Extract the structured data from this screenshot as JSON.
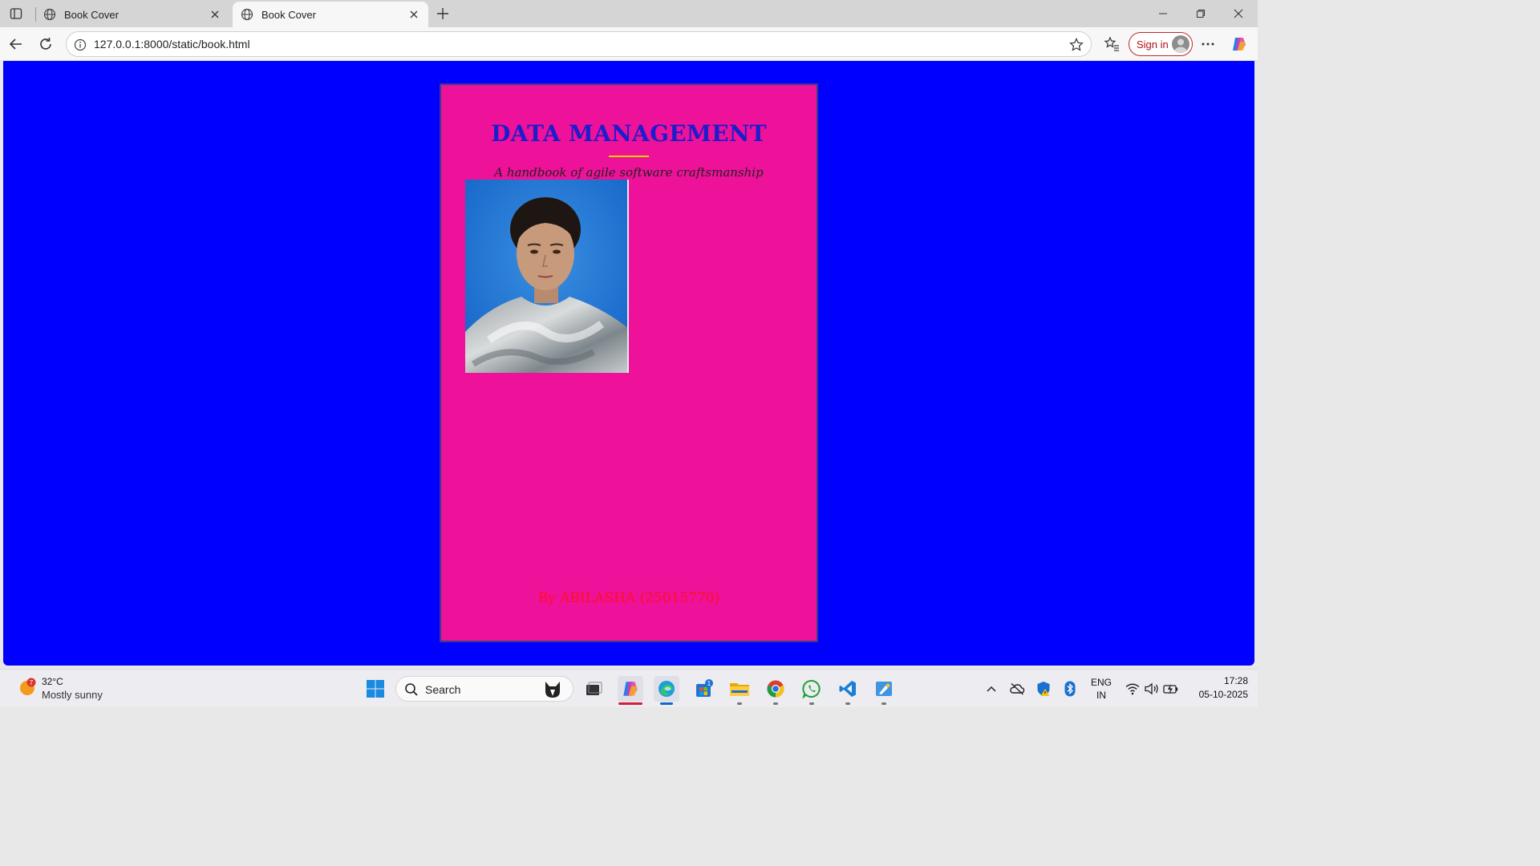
{
  "browser": {
    "tabs": [
      {
        "title": "Book Cover",
        "active": false
      },
      {
        "title": "Book Cover",
        "active": true
      }
    ],
    "address": "127.0.0.1:8000/static/book.html",
    "sign_in_label": "Sign in"
  },
  "book": {
    "title": "DATA MANAGEMENT",
    "subtitle": "A handbook of agile software craftsmanship",
    "author_line": "By ABILASHA (25015770)",
    "colors": {
      "page_background": "#0000ff",
      "cover_background": "#ee1199",
      "title_color": "#1d1dcc",
      "underline_color": "#e8d200",
      "author_color": "#ff1020"
    }
  },
  "taskbar": {
    "weather": {
      "badge": "7",
      "temperature": "32°C",
      "condition": "Mostly sunny"
    },
    "search_label": "Search",
    "pinned_icons": [
      "windows-start-icon",
      "search-icon",
      "cat-app-icon",
      "task-view-icon",
      "copilot-icon",
      "edge-icon",
      "store-icon",
      "file-explorer-icon",
      "chrome-icon",
      "whatsapp-icon",
      "vscode-icon",
      "paint-icon"
    ],
    "store_badge": "1",
    "language": {
      "line1": "ENG",
      "line2": "IN"
    },
    "clock": {
      "time": "17:28",
      "date": "05-10-2025"
    }
  }
}
